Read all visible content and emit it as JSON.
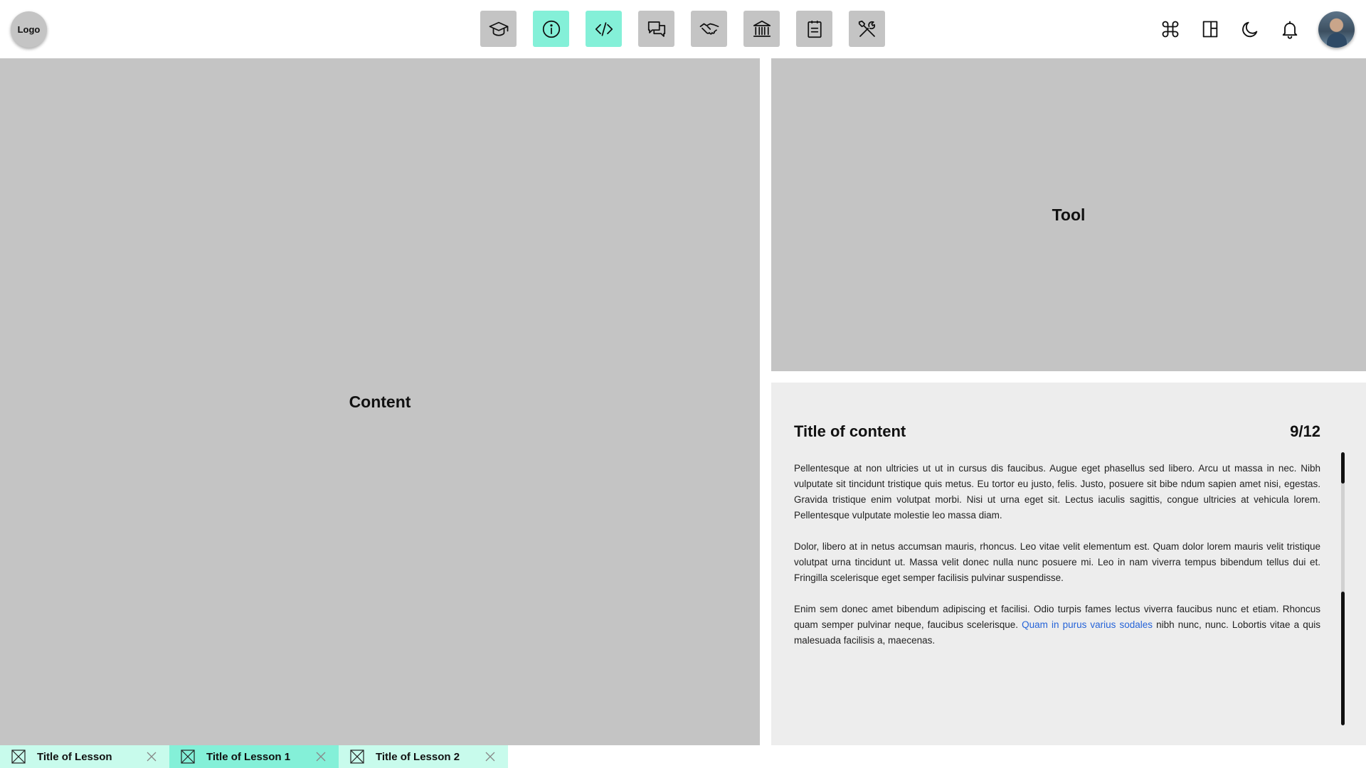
{
  "header": {
    "logo_text": "Logo",
    "nav": [
      {
        "icon": "graduation-cap-icon",
        "active": false
      },
      {
        "icon": "info-icon",
        "active": true
      },
      {
        "icon": "code-icon",
        "active": true
      },
      {
        "icon": "chat-icon",
        "active": false
      },
      {
        "icon": "handshake-icon",
        "active": false
      },
      {
        "icon": "library-icon",
        "active": false
      },
      {
        "icon": "clipboard-icon",
        "active": false
      },
      {
        "icon": "tools-icon",
        "active": false
      }
    ],
    "tools": [
      "command-icon",
      "layout-icon",
      "moon-icon",
      "bell-icon"
    ],
    "accent_color": "#84f0d8"
  },
  "content_panel": {
    "label": "Content"
  },
  "tool_panel": {
    "label": "Tool"
  },
  "reader": {
    "title": "Title of content",
    "page_counter": "9/12",
    "paragraphs": [
      "Pellentesque at non ultricies ut ut in cursus dis faucibus. Augue eget phasellus sed libero. Arcu ut massa in nec. Nibh vulputate sit tincidunt tristique quis metus. Eu tortor eu justo, felis. Justo, posuere sit bibe ndum sapien amet nisi, egestas. Gravida tristique enim volutpat morbi. Nisi ut urna eget sit. Lectus iaculis sagittis, congue ultricies at vehicula lorem. Pellentesque vulputate molestie leo massa diam.",
      "Dolor, libero at in netus accumsan mauris, rhoncus. Leo vitae velit elementum est. Quam dolor lorem mauris velit tristique volutpat urna tincidunt ut. Massa velit donec nulla nunc posuere mi. Leo in nam viverra tempus bibendum tellus dui et. Fringilla scelerisque eget semper facilisis pulvinar suspendisse."
    ],
    "paragraph3_before": "Enim sem donec amet bibendum adipiscing et facilisi. Odio turpis fames lectus viverra faucibus nunc et etiam. Rhoncus quam semper pulvinar neque, faucibus scelerisque. ",
    "paragraph3_link": "Quam in purus varius sodales",
    "paragraph3_after": " nibh nunc, nunc. Lobortis vitae a quis malesuada facilisis a, maecenas."
  },
  "tabs": [
    {
      "title": "Title of Lesson",
      "active": false
    },
    {
      "title": "Title of Lesson 1",
      "active": true
    },
    {
      "title": "Title of Lesson 2",
      "active": false
    }
  ]
}
